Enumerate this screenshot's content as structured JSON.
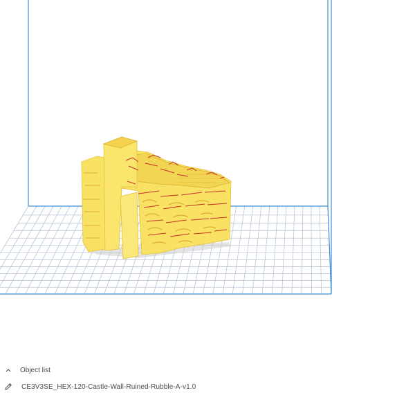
{
  "object_list": {
    "toggle_label": "Object list",
    "toggle_icon": "chevron-up-icon",
    "object_name": "CE3V3SE_HEX-120-Castle-Wall-Ruined-Rubble-A-v1.0",
    "edit_icon": "pencil-icon"
  },
  "colors": {
    "build_volume_edge": "#3e8ed4",
    "grid_line": "#b9c6d3",
    "plate_fill": "#ffffff",
    "model_fill": "#f8e163",
    "model_shade": "#e8c23a",
    "model_detail": "#c8342a"
  }
}
